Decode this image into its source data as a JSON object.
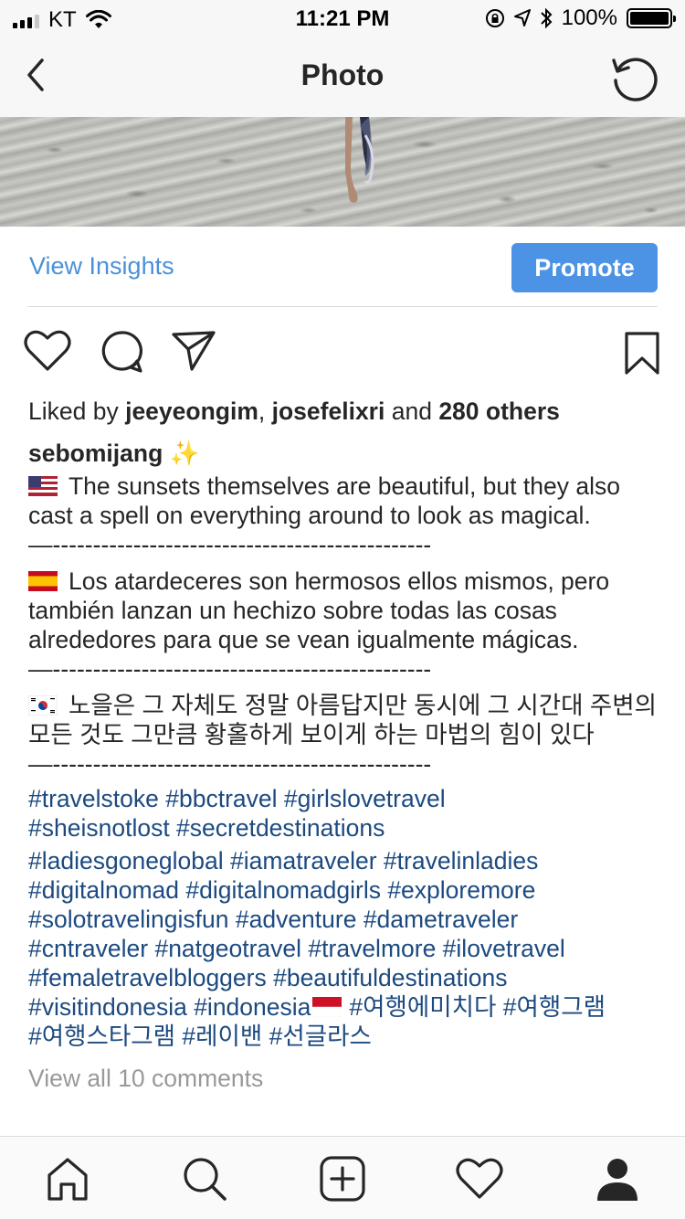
{
  "status_bar": {
    "carrier": "KT",
    "time": "11:21 PM",
    "battery": "100%",
    "battery_level": 1.0,
    "icons": [
      "signal-icon",
      "wifi-icon",
      "rotation-lock-icon",
      "location-icon",
      "bluetooth-icon",
      "battery-icon"
    ]
  },
  "nav": {
    "title": "Photo",
    "back_icon": "chevron-left-icon",
    "refresh_icon": "refresh-icon"
  },
  "insights": {
    "view_insights_label": "View Insights",
    "promote_label": "Promote",
    "promote_color": "#4c93e5",
    "link_color": "#4a90d9"
  },
  "actions": {
    "icons": [
      "heart-icon",
      "comment-icon",
      "share-icon",
      "bookmark-icon"
    ]
  },
  "likes": {
    "prefix": "Liked by ",
    "user1": "jeeyeongim",
    "sep": ", ",
    "user2": "josefelixri",
    "and": " and ",
    "others": "280 others"
  },
  "caption": {
    "username": "sebomijang",
    "sparkle": "✨",
    "en_text": "The sunsets themselves are beautiful, but they also cast a spell on everything around to look as magical.",
    "divider": "—-----------------------------------------------",
    "es_text": "Los atardeceres son hermosos ellos mismos, pero también lanzan un hechizo sobre todas las cosas alrededores para que se vean igualmente mágicas.",
    "ko_text": "노을은 그 자체도 정말 아름답지만 동시에 그 시간대 주변의 모든 것도 그만큼 황홀하게 보이게 하는 마법의 힘이 있다",
    "hashtags_1": [
      "#travelstoke #bbctravel #girlslovetravel",
      "#sheisnotlost #secretdestinations"
    ],
    "hashtags_2": [
      "#ladiesgoneglobal #iamatraveler #travelinladies",
      "#digitalnomad #digitalnomadgirls #exploremore",
      "#solotravelingisfun #adventure #dametraveler",
      "#cntraveler #natgeotravel #travelmore #ilovetravel",
      "#femaletravelbloggers #beautifuldestinations"
    ],
    "hashtag_last_a": "#visitindonesia #indonesia",
    "hashtag_last_b": "#여행에미치다 #여행그램",
    "hashtag_last_c": "#여행스타그램 #레이밴 #선글라스",
    "hashtag_color": "#1c4a80"
  },
  "comments": {
    "view_all": "View all 10 comments"
  },
  "tab_bar": {
    "icons": [
      "home-icon",
      "search-icon",
      "new-post-icon",
      "activity-icon",
      "profile-icon"
    ]
  }
}
